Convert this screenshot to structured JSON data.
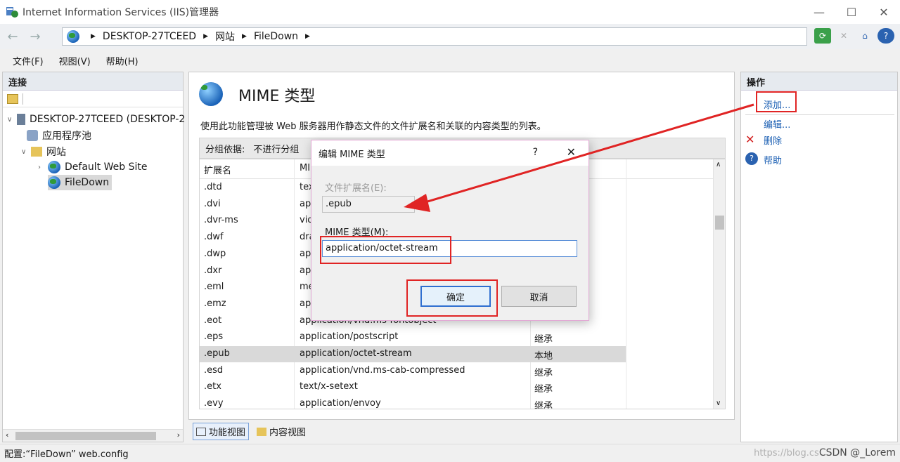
{
  "window": {
    "title": "Internet Information Services (IIS)管理器",
    "minimize_icon": "minimize-icon",
    "maximize_icon": "maximize-icon",
    "close_icon": "close-icon"
  },
  "nav": {
    "breadcrumb": [
      "DESKTOP-27TCEED",
      "网站",
      "FileDown"
    ]
  },
  "menu": [
    "文件(F)",
    "视图(V)",
    "帮助(H)"
  ],
  "connections": {
    "header": "连接",
    "tree": [
      {
        "label": "DESKTOP-27TCEED (DESKTOP-2"
      },
      {
        "label": "应用程序池"
      },
      {
        "label": "网站"
      },
      {
        "label": "Default Web Site"
      },
      {
        "label": "FileDown"
      }
    ]
  },
  "main": {
    "title": "MIME 类型",
    "description": "使用此功能管理被 Web 服务器用作静态文件的文件扩展名和关联的内容类型的列表。",
    "group_label": "分组依据:",
    "group_value": "不进行分组",
    "columns": [
      "扩展名",
      "MI"
    ],
    "rows": [
      {
        "ext": ".dtd",
        "mime": "tex",
        "type": ""
      },
      {
        "ext": ".dvi",
        "mime": "ap",
        "type": ""
      },
      {
        "ext": ".dvr-ms",
        "mime": "vid",
        "type": ""
      },
      {
        "ext": ".dwf",
        "mime": "dra",
        "type": ""
      },
      {
        "ext": ".dwp",
        "mime": "ap",
        "type": ""
      },
      {
        "ext": ".dxr",
        "mime": "ap",
        "type": ""
      },
      {
        "ext": ".eml",
        "mime": "me",
        "type": ""
      },
      {
        "ext": ".emz",
        "mime": "ap",
        "type": ""
      },
      {
        "ext": ".eot",
        "mime": "application/vnd.ms-fontobject",
        "type": ""
      },
      {
        "ext": ".eps",
        "mime": "application/postscript",
        "type": "继承"
      },
      {
        "ext": ".epub",
        "mime": "application/octet-stream",
        "type": "本地"
      },
      {
        "ext": ".esd",
        "mime": "application/vnd.ms-cab-compressed",
        "type": "继承"
      },
      {
        "ext": ".etx",
        "mime": "text/x-setext",
        "type": "继承"
      },
      {
        "ext": ".evy",
        "mime": "application/envoy",
        "type": "继承"
      }
    ],
    "view_tabs": [
      "功能视图",
      "内容视图"
    ]
  },
  "actions": {
    "header": "操作",
    "items": [
      "添加...",
      "编辑...",
      "删除",
      "帮助"
    ]
  },
  "dialog": {
    "title": "编辑 MIME 类型",
    "help": "?",
    "ext_label": "文件扩展名(E):",
    "ext_value": ".epub",
    "mime_label": "MIME 类型(M):",
    "mime_value": "application/octet-stream",
    "ok": "确定",
    "cancel": "取消"
  },
  "status": {
    "text": "配置:“FileDown” web.config"
  },
  "watermark": {
    "left": "https://blog.cs",
    "right": "CSDN @_Lorem"
  },
  "colors": {
    "highlight": "#e02424",
    "link": "#1b5fb3"
  }
}
